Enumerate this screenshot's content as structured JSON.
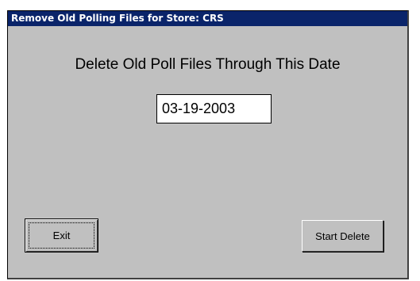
{
  "window": {
    "title": "Remove Old Polling Files for Store: CRS"
  },
  "form": {
    "heading": "Delete Old Poll Files Through This Date",
    "date_value": "03-19-2003"
  },
  "buttons": {
    "exit_label": "Exit",
    "start_delete_label": "Start Delete"
  },
  "colors": {
    "titlebar": "#0a246a",
    "dialog_background": "#c0c0c0"
  }
}
